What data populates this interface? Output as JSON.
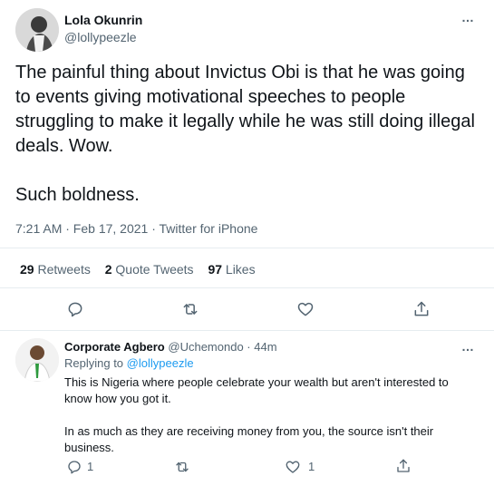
{
  "main_tweet": {
    "author_name": "Lola Okunrin",
    "author_handle": "@lollypeezle",
    "text": "The painful thing about Invictus Obi is that he was going to events giving motivational speeches to people struggling to make it legally while he was still doing illegal deals. Wow.\n\nSuch boldness.",
    "timestamp": "7:21 AM · Feb 17, 2021 · Twitter for iPhone",
    "stats": {
      "retweets_count": "29",
      "retweets_label": "Retweets",
      "quotes_count": "2",
      "quotes_label": "Quote Tweets",
      "likes_count": "97",
      "likes_label": "Likes"
    },
    "more_icon": "…",
    "actions": [
      "reply-icon",
      "retweet-icon",
      "like-icon",
      "share-icon"
    ]
  },
  "reply_tweet": {
    "author_name": "Corporate Agbero",
    "author_handle": "@Uchemondo",
    "time": "· 44m",
    "replying_prefix": "Replying to",
    "replying_handle": "@lollypeezle",
    "text": "This is Nigeria where people celebrate your wealth but aren't interested to know how you got it.\n\nIn as much as they are receiving money from you, the source isn't their business.",
    "reply_count": "1",
    "like_count": "1",
    "more_icon": "…"
  },
  "colors": {
    "text": "#0f1419",
    "muted": "#536471",
    "link": "#1d9bf0",
    "divider": "#e6ecf0"
  }
}
